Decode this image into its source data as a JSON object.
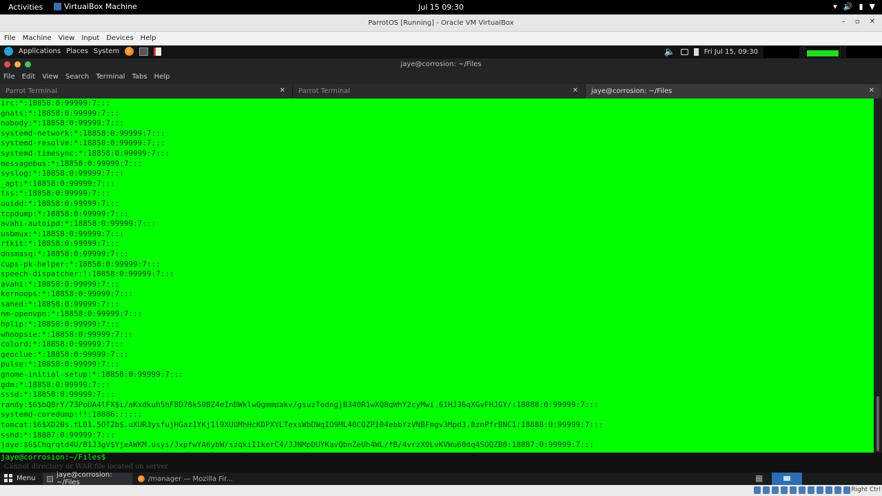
{
  "gnome": {
    "activities": "Activities",
    "app_name": "VirtualBox Machine",
    "clock": "Jul 15  09:30"
  },
  "vbox": {
    "title": "ParrotOS [Running] - Oracle VM VirtualBox",
    "menu": [
      "File",
      "Machine",
      "View",
      "Input",
      "Devices",
      "Help"
    ],
    "host_key": "Right Ctrl"
  },
  "guest_panel": {
    "menu": [
      "Applications",
      "Places",
      "System"
    ],
    "clock": "Fri Jul 15, 09:30"
  },
  "terminal": {
    "title": "jaye@corrosion: ~/Files",
    "menu": [
      "File",
      "Edit",
      "View",
      "Search",
      "Terminal",
      "Tabs",
      "Help"
    ],
    "tabs": [
      {
        "label": "Parrot Terminal"
      },
      {
        "label": "Parrot Terminal"
      },
      {
        "label": "jaye@corrosion: ~/Files"
      }
    ],
    "output": "irc:*:18858:0:99999:7:::\ngnats:*:18858:0:99999:7:::\nnobody:*:18858:0:99999:7:::\nsystemd-network:*:18858:0:99999:7:::\nsystemd-resolve:*:18858:0:99999:7:::\nsystemd-timesync:*:18858:0:99999:7:::\nmessagebus:*:18858:0:99999:7:::\nsyslog:*:18858:0:99999:7:::\n_apt:*:18858:0:99999:7:::\ntss:*:18858:0:99999:7:::\nuuidd:*:18858:0:99999:7:::\ntcpdump:*:18858:0:99999:7:::\navahi-autoipd:*:18858:0:99999:7:::\nusbmux:*:18858:0:99999:7:::\nrtkit:*:18858:0:99999:7:::\ndnsmasq:*:18858:0:99999:7:::\ncups-pk-helper:*:18858:0:99999:7:::\nspeech-dispatcher:!:18858:0:99999:7:::\navahi:*:18858:0:99999:7:::\nkernoops:*:18858:0:99999:7:::\nsaned:*:18858:0:99999:7:::\nnm-openvpn:*:18858:0:99999:7:::\nhplip:*:18858:0:99999:7:::\nwhoopsie:*:18858:0:99999:7:::\ncolord:*:18858:0:99999:7:::\ngeoclue:*:18858:0:99999:7:::\npulse:*:18858:0:99999:7:::\ngnome-initial-setup:*:18858:0:99999:7:::\ngdm:*:18858:0:99999:7:::\nsssd:*:18858:0:99999:7:::\nrandy:$6$bQ8rY/73PoUA4lFX$i/aKxdkuh5hF8D78k50BZ4eInDWklwQgmmpakv/gsuzTodngjB340R1wXQ8qWhY2cyMwi.61HJ36qXGvFHJGY/:18888:0:99999:7:::\nsystemd-coredump:!!:18886::::::\ntomcat:$6$XD2Bs.tL01.5OT2b$.uXUR3ysfujHGaz1YKj1l9XUOMhHcKDPXYLTexsWbDWqIO9ML40CQZPI04ebbYzVNBFmgv3Mpd3.8znPfrBNC1:18888:0:99999:7:::\nsshd:*:18887:0:99999:7:::\njaye:$6$Chqrqtd4U/B1J3gV$YjeAWKM.usyi/JxpfwYA6ybW/szqkiI1kerC4/JJNMpDUYKavQbnZeUh4WL/fB/4vrzX0LvKVWu60dq4SOQZB0:18887:0:99999:7:::",
    "prompt": "jaye@corrosion:~/Files$",
    "background_text": "Cannot directory or WAR file located on server"
  },
  "taskbar": {
    "menu": "Menu",
    "tasks": [
      {
        "label": "jaye@corrosion: ~/Files"
      },
      {
        "label": "/manager — Mozilla Fir..."
      }
    ]
  },
  "colors": {
    "terminal_bg": "#00ff00",
    "prompt_fg": "#00ff00"
  }
}
